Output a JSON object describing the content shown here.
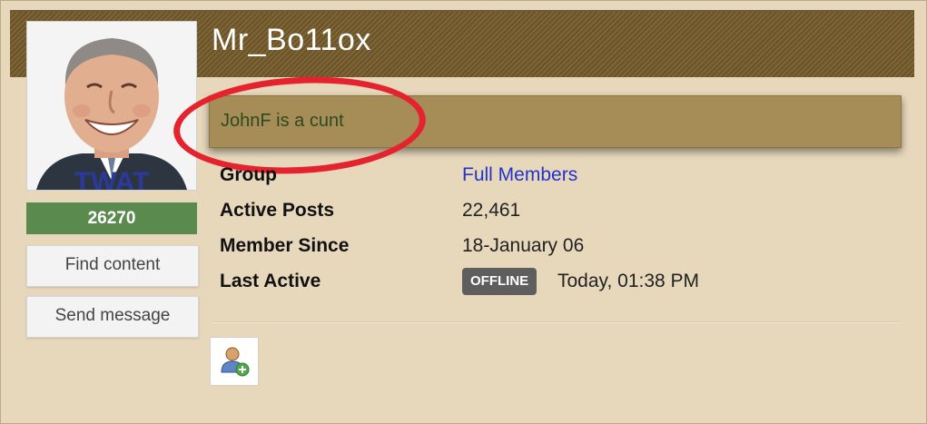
{
  "profile": {
    "username": "Mr_Bo11ox",
    "status_message": "JohnF is a cunt",
    "reputation": "26270",
    "avatar_caption": "TWAT"
  },
  "buttons": {
    "find_content": "Find content",
    "send_message": "Send message"
  },
  "info": {
    "group_label": "Group",
    "group_value": "Full Members",
    "posts_label": "Active Posts",
    "posts_value": "22,461",
    "member_since_label": "Member Since",
    "member_since_value": "18-January 06",
    "last_active_label": "Last Active",
    "online_badge": "OFFLINE",
    "last_active_value": "Today, 01:38 PM"
  },
  "icons": {
    "add_friend": "user-add-icon"
  },
  "colors": {
    "header": "#6f5a30",
    "status_bg": "#a68c57",
    "reputation_bg": "#5b8a4f",
    "link": "#2233cc",
    "annotation_circle": "#e5232f"
  }
}
